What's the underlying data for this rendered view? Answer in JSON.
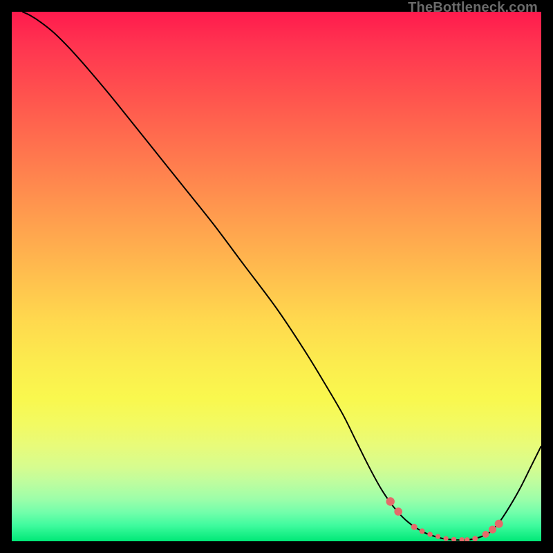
{
  "watermark": "TheBottleneck.com",
  "colors": {
    "curve_stroke": "#000000",
    "dot_fill": "#e46a6a",
    "background": "#000000"
  },
  "chart_data": {
    "type": "line",
    "title": "",
    "xlabel": "",
    "ylabel": "",
    "xlim": [
      0,
      100
    ],
    "ylim": [
      0,
      100
    ],
    "series": [
      {
        "name": "bottleneck-curve",
        "x": [
          2.0,
          3.5,
          5.5,
          8.0,
          11.0,
          15.0,
          20.0,
          26.0,
          32.0,
          38.0,
          44.0,
          50.0,
          55.0,
          59.0,
          62.5,
          65.0,
          67.5,
          70.0,
          72.5,
          75.0,
          78.0,
          81.0,
          83.0,
          85.5,
          87.5,
          90.0,
          92.0,
          94.0,
          96.0,
          98.0,
          100.0
        ],
        "values": [
          100.0,
          99.3,
          98.0,
          96.0,
          93.0,
          88.5,
          82.5,
          75.0,
          67.5,
          60.0,
          52.0,
          44.0,
          36.5,
          30.0,
          24.0,
          19.0,
          14.0,
          9.5,
          6.0,
          3.5,
          1.6,
          0.6,
          0.3,
          0.25,
          0.5,
          1.5,
          3.5,
          6.5,
          10.0,
          14.0,
          18.0
        ]
      }
    ],
    "markers": {
      "name": "highlight-dots",
      "x": [
        71.5,
        73.0,
        76.0,
        77.5,
        79.0,
        80.5,
        82.0,
        83.5,
        85.0,
        86.0,
        87.5,
        89.5,
        90.8,
        92.0
      ],
      "values": [
        7.5,
        5.6,
        2.7,
        1.9,
        1.3,
        0.9,
        0.5,
        0.35,
        0.3,
        0.3,
        0.5,
        1.3,
        2.2,
        3.3
      ],
      "radius": [
        6.2,
        5.8,
        4.5,
        4.0,
        3.8,
        3.6,
        3.6,
        3.6,
        3.6,
        3.6,
        4.0,
        5.0,
        5.6,
        6.0
      ]
    }
  }
}
